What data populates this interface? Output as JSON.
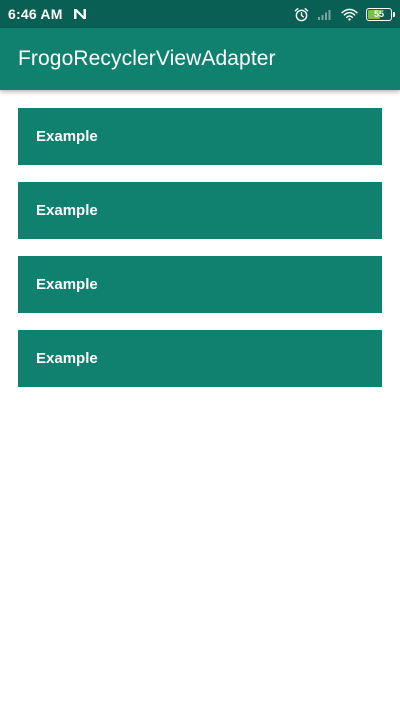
{
  "status_bar": {
    "time": "6:46 AM",
    "notification_icon": "n-app-icon",
    "icons": [
      "alarm-icon",
      "signal-icon",
      "wifi-icon"
    ],
    "battery_level": "55",
    "battery_fraction": 0.55,
    "battery_color": "#7ac142"
  },
  "app_bar": {
    "title": "FrogoRecyclerViewAdapter",
    "color": "#10806f"
  },
  "list": {
    "items": [
      {
        "label": "Example"
      },
      {
        "label": "Example"
      },
      {
        "label": "Example"
      },
      {
        "label": "Example"
      }
    ]
  },
  "colors": {
    "primary": "#10806f",
    "primary_dark": "#0a5f55",
    "background": "#ffffff"
  }
}
